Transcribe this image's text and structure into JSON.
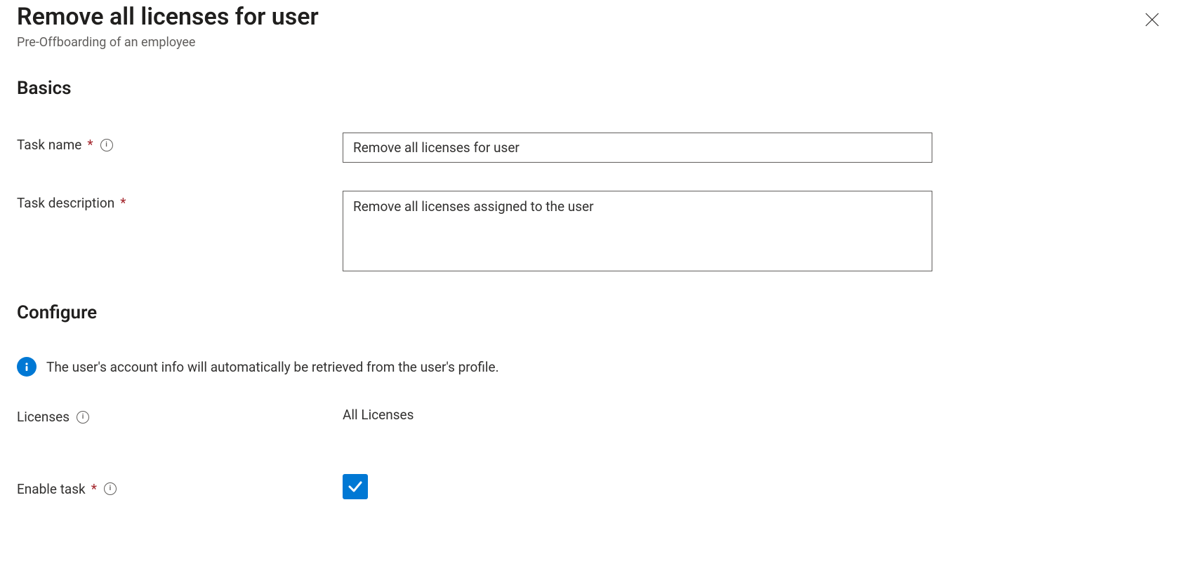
{
  "header": {
    "title": "Remove all licenses for user",
    "subtitle": "Pre-Offboarding of an employee"
  },
  "sections": {
    "basics": {
      "heading": "Basics",
      "task_name_label": "Task name",
      "task_name_value": "Remove all licenses for user",
      "task_description_label": "Task description",
      "task_description_value": "Remove all licenses assigned to the user"
    },
    "configure": {
      "heading": "Configure",
      "info_text": "The user's account info will automatically be retrieved from the user's profile.",
      "licenses_label": "Licenses",
      "licenses_value": "All Licenses",
      "enable_task_label": "Enable task",
      "enable_task_checked": true
    }
  }
}
